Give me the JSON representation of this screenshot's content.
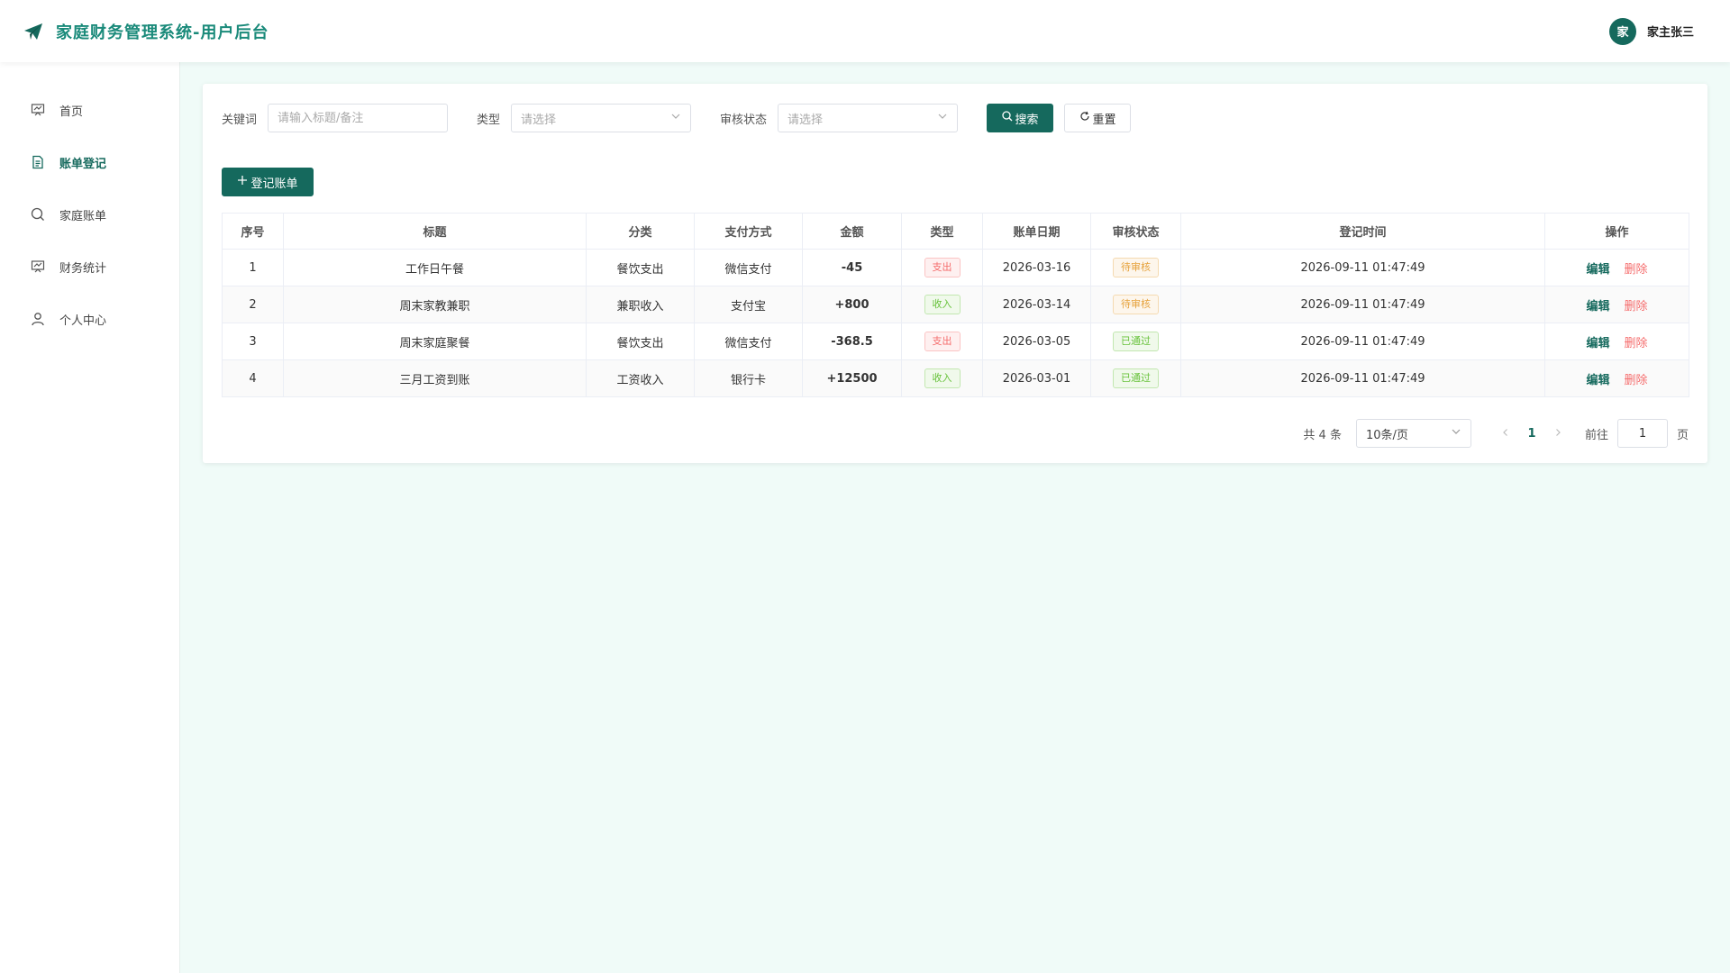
{
  "header": {
    "title": "家庭财务管理系统-用户后台",
    "avatar_text": "家",
    "user_name": "家主张三"
  },
  "sidebar": {
    "items": [
      {
        "label": "首页",
        "icon": "chart-board-icon"
      },
      {
        "label": "账单登记",
        "icon": "document-icon",
        "active": true
      },
      {
        "label": "家庭账单",
        "icon": "search-icon"
      },
      {
        "label": "财务统计",
        "icon": "chart-board-icon"
      },
      {
        "label": "个人中心",
        "icon": "user-icon"
      }
    ]
  },
  "filters": {
    "keyword_label": "关键词",
    "keyword_placeholder": "请输入标题/备注",
    "type_label": "类型",
    "type_placeholder": "请选择",
    "status_label": "审核状态",
    "status_placeholder": "请选择",
    "search_label": "搜索",
    "reset_label": "重置"
  },
  "actions": {
    "add_label": "登记账单"
  },
  "table": {
    "headers": [
      "序号",
      "标题",
      "分类",
      "支付方式",
      "金额",
      "类型",
      "账单日期",
      "审核状态",
      "登记时间",
      "操作"
    ],
    "edit_label": "编辑",
    "delete_label": "删除",
    "rows": [
      {
        "no": "1",
        "title": "工作日午餐",
        "category": "餐饮支出",
        "pay": "微信支付",
        "amount": "-45",
        "type": "支出",
        "date": "2026-03-16",
        "status": "待审核",
        "created": "2026-09-11 01:47:49"
      },
      {
        "no": "2",
        "title": "周末家教兼职",
        "category": "兼职收入",
        "pay": "支付宝",
        "amount": "+800",
        "type": "收入",
        "date": "2026-03-14",
        "status": "待审核",
        "created": "2026-09-11 01:47:49"
      },
      {
        "no": "3",
        "title": "周末家庭聚餐",
        "category": "餐饮支出",
        "pay": "微信支付",
        "amount": "-368.5",
        "type": "支出",
        "date": "2026-03-05",
        "status": "已通过",
        "created": "2026-09-11 01:47:49"
      },
      {
        "no": "4",
        "title": "三月工资到账",
        "category": "工资收入",
        "pay": "银行卡",
        "amount": "+12500",
        "type": "收入",
        "date": "2026-03-01",
        "status": "已通过",
        "created": "2026-09-11 01:47:49"
      }
    ]
  },
  "pager": {
    "total_text": "共 4 条",
    "page_size": "10条/页",
    "current_page": "1",
    "goto_label": "前往",
    "goto_value": "1",
    "page_suffix": "页"
  },
  "colors": {
    "primary": "#15695d",
    "danger": "#f56c6c",
    "success": "#67c23a",
    "warning": "#e6a23c"
  }
}
